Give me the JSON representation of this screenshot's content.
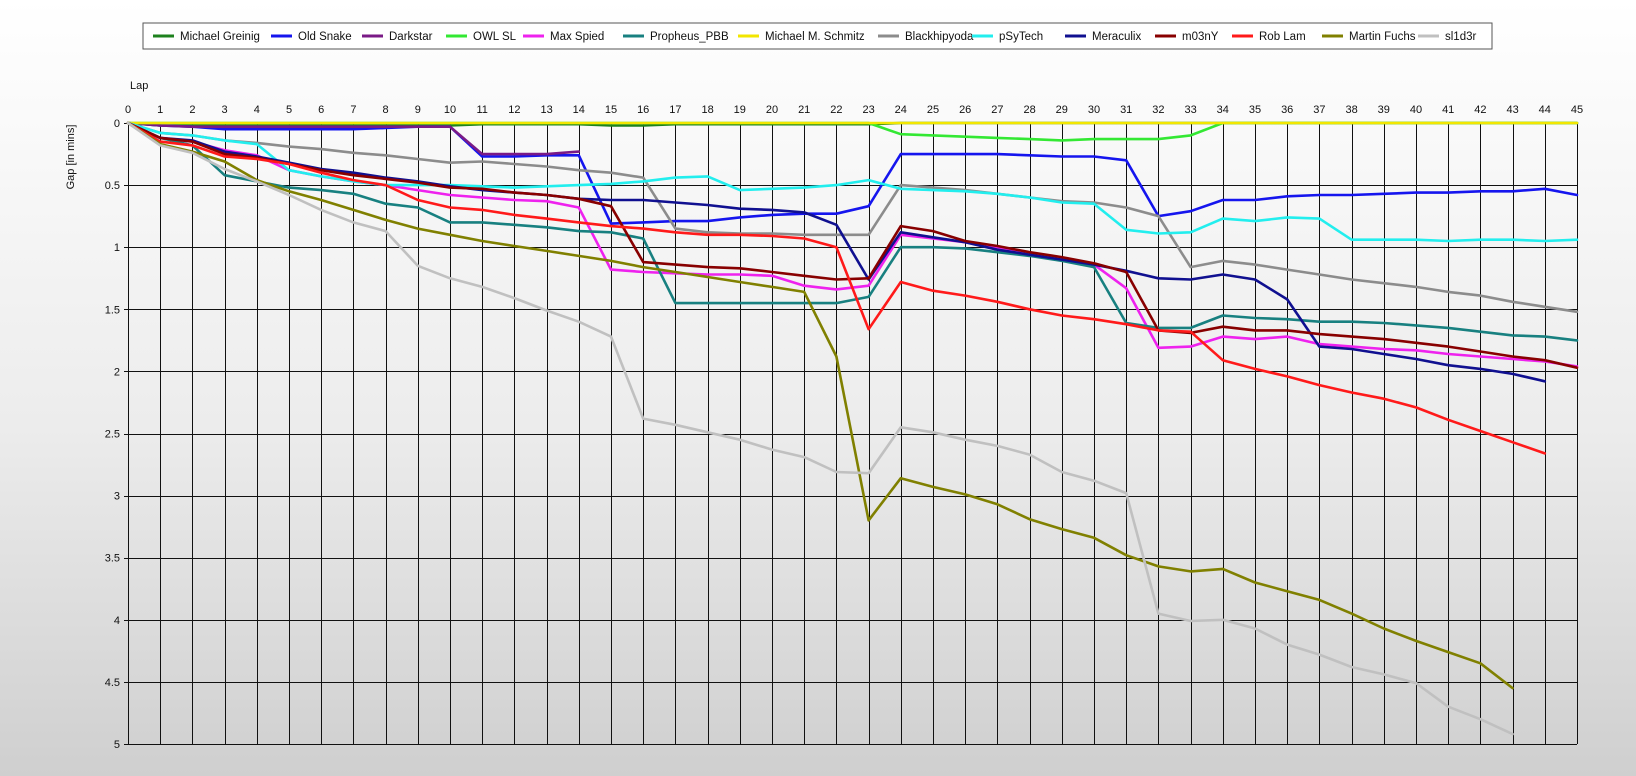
{
  "chart_data": {
    "type": "line",
    "title": "",
    "xlabel": "Lap",
    "ylabel": "Gap [in mins]",
    "xlim": [
      0,
      45
    ],
    "ylim": [
      0,
      5
    ],
    "y_inverted": true,
    "grid": true,
    "legend_position": "top",
    "x_ticks": [
      0,
      1,
      2,
      3,
      4,
      5,
      6,
      7,
      8,
      9,
      10,
      11,
      12,
      13,
      14,
      15,
      16,
      17,
      18,
      19,
      20,
      21,
      22,
      23,
      24,
      25,
      26,
      27,
      28,
      29,
      30,
      31,
      32,
      33,
      34,
      35,
      36,
      37,
      38,
      39,
      40,
      41,
      42,
      43,
      44,
      45
    ],
    "y_ticks": [
      {
        "value": 0,
        "label": "0"
      },
      {
        "value": 0.5,
        "label": "0.5"
      },
      {
        "value": 1,
        "label": "1"
      },
      {
        "value": 1.5,
        "label": "1.5"
      },
      {
        "value": 2,
        "label": "2"
      },
      {
        "value": 2.5,
        "label": "2.5"
      },
      {
        "value": 3,
        "label": "3"
      },
      {
        "value": 3.5,
        "label": "3.5"
      },
      {
        "value": 4,
        "label": "4"
      },
      {
        "value": 4.5,
        "label": "4.5"
      },
      {
        "value": 5,
        "label": "5"
      }
    ],
    "series": [
      {
        "name": "Michael Greinig",
        "color": "#1e821e",
        "x_start": 0,
        "values": [
          0,
          0.02,
          0.02,
          0.02,
          0.02,
          0.02,
          0.02,
          0.02,
          0.02,
          0.02,
          0.02,
          0.01,
          0.01,
          0.01,
          0.01,
          0.02,
          0.02,
          0.01,
          0.01,
          0.01,
          0.01,
          0.01,
          0.01,
          0.01,
          0,
          0,
          0,
          0,
          0,
          0,
          0,
          0,
          0,
          0,
          0,
          0,
          0,
          0,
          0,
          0,
          0,
          0,
          0,
          0,
          0,
          0
        ]
      },
      {
        "name": "Old Snake",
        "color": "#1515ee",
        "x_start": 0,
        "values": [
          0,
          0.02,
          0.03,
          0.05,
          0.05,
          0.05,
          0.05,
          0.05,
          0.04,
          0.03,
          0.03,
          0.27,
          0.27,
          0.26,
          0.26,
          0.81,
          0.8,
          0.79,
          0.79,
          0.76,
          0.74,
          0.73,
          0.73,
          0.67,
          0.25,
          0.25,
          0.25,
          0.25,
          0.26,
          0.27,
          0.27,
          0.3,
          0.75,
          0.71,
          0.62,
          0.62,
          0.59,
          0.58,
          0.58,
          0.57,
          0.56,
          0.56,
          0.55,
          0.55,
          0.53,
          0.58
        ]
      },
      {
        "name": "Darkstar",
        "color": "#7a1a86",
        "x_start": 0,
        "values": [
          0,
          0.02,
          0.03,
          0.03,
          0.03,
          0.03,
          0.03,
          0.03,
          0.03,
          0.03,
          0.03,
          0.25,
          0.25,
          0.25,
          0.23
        ]
      },
      {
        "name": "OWL SL",
        "color": "#33e833",
        "x_start": 0,
        "values": [
          0,
          0,
          0,
          0,
          0,
          0,
          0,
          0,
          0,
          0,
          0,
          0,
          0,
          0,
          0,
          0,
          0,
          0,
          0,
          0,
          0,
          0,
          0,
          0,
          0.09,
          0.1,
          0.11,
          0.12,
          0.13,
          0.14,
          0.13,
          0.13,
          0.13,
          0.1,
          0,
          0,
          0,
          0,
          0,
          0,
          0,
          0,
          0,
          0,
          0,
          0
        ]
      },
      {
        "name": "Max Spied",
        "color": "#ee22ee",
        "x_start": 0,
        "values": [
          0,
          0.12,
          0.15,
          0.22,
          0.26,
          0.38,
          0.43,
          0.47,
          0.5,
          0.54,
          0.58,
          0.6,
          0.62,
          0.63,
          0.68,
          1.18,
          1.2,
          1.21,
          1.22,
          1.22,
          1.23,
          1.31,
          1.34,
          1.31,
          0.9,
          0.93,
          0.96,
          1.0,
          1.05,
          1.09,
          1.14,
          1.33,
          1.81,
          1.8,
          1.72,
          1.74,
          1.72,
          1.78,
          1.8,
          1.82,
          1.83,
          1.86,
          1.88,
          1.9,
          1.92,
          1.96
        ]
      },
      {
        "name": "Propheus_PBB",
        "color": "#188080",
        "x_start": 0,
        "values": [
          0,
          0.12,
          0.18,
          0.42,
          0.47,
          0.52,
          0.54,
          0.57,
          0.65,
          0.68,
          0.8,
          0.8,
          0.82,
          0.84,
          0.87,
          0.88,
          0.93,
          1.45,
          1.45,
          1.45,
          1.45,
          1.45,
          1.45,
          1.4,
          1.0,
          1.0,
          1.01,
          1.04,
          1.07,
          1.11,
          1.16,
          1.61,
          1.65,
          1.65,
          1.55,
          1.57,
          1.58,
          1.6,
          1.6,
          1.61,
          1.63,
          1.65,
          1.68,
          1.71,
          1.72,
          1.75
        ]
      },
      {
        "name": "Michael M. Schmitz",
        "color": "#f2e600",
        "x_start": 0,
        "values": [
          0,
          0,
          0,
          0,
          0,
          0,
          0,
          0,
          0,
          0,
          0,
          0,
          0,
          0,
          0,
          0,
          0,
          0,
          0,
          0,
          0,
          0,
          0,
          0,
          0,
          0,
          0,
          0,
          0,
          0,
          0,
          0,
          0,
          0,
          0,
          0,
          0,
          0,
          0,
          0,
          0,
          0,
          0,
          0,
          0,
          0
        ]
      },
      {
        "name": "Blackhipyoda",
        "color": "#8c8c8c",
        "x_start": 0,
        "values": [
          0,
          0.08,
          0.1,
          0.14,
          0.16,
          0.19,
          0.21,
          0.24,
          0.26,
          0.29,
          0.32,
          0.31,
          0.33,
          0.35,
          0.38,
          0.4,
          0.44,
          0.85,
          0.88,
          0.89,
          0.89,
          0.9,
          0.9,
          0.9,
          0.5,
          0.52,
          0.54,
          0.57,
          0.6,
          0.63,
          0.64,
          0.68,
          0.75,
          1.16,
          1.11,
          1.14,
          1.18,
          1.22,
          1.26,
          1.29,
          1.32,
          1.36,
          1.39,
          1.44,
          1.48,
          1.52
        ]
      },
      {
        "name": "pSyTech",
        "color": "#22eeee",
        "x_start": 0,
        "values": [
          0,
          0.08,
          0.1,
          0.14,
          0.17,
          0.38,
          0.43,
          0.47,
          0.5,
          0.5,
          0.5,
          0.51,
          0.52,
          0.51,
          0.5,
          0.49,
          0.47,
          0.44,
          0.43,
          0.54,
          0.53,
          0.52,
          0.5,
          0.46,
          0.53,
          0.54,
          0.55,
          0.57,
          0.6,
          0.64,
          0.65,
          0.86,
          0.89,
          0.88,
          0.77,
          0.79,
          0.76,
          0.77,
          0.94,
          0.94,
          0.94,
          0.95,
          0.94,
          0.94,
          0.95,
          0.94
        ]
      },
      {
        "name": "Meraculix",
        "color": "#101090",
        "x_start": 0,
        "values": [
          0,
          0.12,
          0.14,
          0.23,
          0.27,
          0.32,
          0.37,
          0.4,
          0.44,
          0.47,
          0.51,
          0.54,
          0.56,
          0.58,
          0.61,
          0.62,
          0.62,
          0.64,
          0.66,
          0.69,
          0.7,
          0.72,
          0.82,
          1.26,
          0.88,
          0.92,
          0.96,
          1.02,
          1.06,
          1.1,
          1.14,
          1.19,
          1.25,
          1.26,
          1.22,
          1.26,
          1.42,
          1.8,
          1.82,
          1.86,
          1.9,
          1.95,
          1.98,
          2.02,
          2.08
        ]
      },
      {
        "name": "m03nY",
        "color": "#880000",
        "x_start": 0,
        "values": [
          0,
          0.12,
          0.15,
          0.25,
          0.28,
          0.33,
          0.38,
          0.42,
          0.45,
          0.48,
          0.52,
          0.53,
          0.56,
          0.58,
          0.61,
          0.67,
          1.12,
          1.14,
          1.16,
          1.17,
          1.2,
          1.23,
          1.26,
          1.25,
          0.83,
          0.87,
          0.95,
          0.99,
          1.04,
          1.08,
          1.13,
          1.2,
          1.67,
          1.69,
          1.64,
          1.67,
          1.67,
          1.7,
          1.72,
          1.74,
          1.77,
          1.8,
          1.84,
          1.88,
          1.91,
          1.97
        ]
      },
      {
        "name": "Rob Lam",
        "color": "#ff1a1a",
        "x_start": 0,
        "values": [
          0,
          0.15,
          0.18,
          0.27,
          0.29,
          0.33,
          0.4,
          0.46,
          0.5,
          0.62,
          0.68,
          0.7,
          0.74,
          0.77,
          0.8,
          0.83,
          0.85,
          0.88,
          0.9,
          0.9,
          0.91,
          0.93,
          1.0,
          1.66,
          1.28,
          1.35,
          1.39,
          1.44,
          1.5,
          1.55,
          1.58,
          1.62,
          1.67,
          1.68,
          1.91,
          1.98,
          2.04,
          2.11,
          2.17,
          2.22,
          2.29,
          2.39,
          2.48,
          2.57,
          2.66
        ]
      },
      {
        "name": "Martin Fuchs",
        "color": "#808000",
        "x_start": 0,
        "values": [
          0,
          0.17,
          0.23,
          0.31,
          0.46,
          0.55,
          0.62,
          0.7,
          0.78,
          0.85,
          0.9,
          0.95,
          0.99,
          1.03,
          1.07,
          1.11,
          1.16,
          1.2,
          1.24,
          1.28,
          1.32,
          1.36,
          1.88,
          3.2,
          2.86,
          2.93,
          2.99,
          3.07,
          3.19,
          3.27,
          3.34,
          3.48,
          3.57,
          3.61,
          3.59,
          3.7,
          3.77,
          3.84,
          3.95,
          4.07,
          4.17,
          4.26,
          4.35,
          4.55
        ]
      },
      {
        "name": "sl1d3r",
        "color": "#c0c0c0",
        "x_start": 0,
        "values": [
          0,
          0.18,
          0.24,
          0.37,
          0.47,
          0.58,
          0.7,
          0.8,
          0.87,
          1.15,
          1.25,
          1.32,
          1.41,
          1.51,
          1.6,
          1.72,
          2.38,
          2.43,
          2.49,
          2.55,
          2.63,
          2.69,
          2.81,
          2.82,
          2.45,
          2.49,
          2.55,
          2.6,
          2.67,
          2.81,
          2.88,
          2.98,
          3.95,
          4.01,
          4.0,
          4.07,
          4.2,
          4.28,
          4.38,
          4.44,
          4.51,
          4.7,
          4.8,
          4.92
        ]
      }
    ]
  }
}
